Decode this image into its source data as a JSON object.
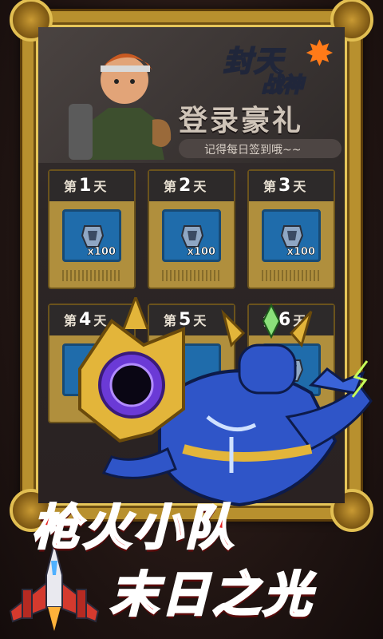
{
  "logo": {
    "line1": "封天",
    "line2": "战神"
  },
  "banner": {
    "title": "登录豪礼",
    "subtitle": "记得每日签到哦~~"
  },
  "days": [
    {
      "prefix": "第",
      "num": "1",
      "suffix": "天",
      "qty": "x100"
    },
    {
      "prefix": "第",
      "num": "2",
      "suffix": "天",
      "qty": "x100"
    },
    {
      "prefix": "第",
      "num": "3",
      "suffix": "天",
      "qty": "x100"
    },
    {
      "prefix": "第",
      "num": "4",
      "suffix": "天",
      "qty": ""
    },
    {
      "prefix": "第",
      "num": "5",
      "suffix": "天",
      "qty": ""
    },
    {
      "prefix": "第",
      "num": "6",
      "suffix": "天",
      "qty": ""
    }
  ],
  "promo": {
    "line1": "枪火小队",
    "line2": "末日之光"
  },
  "colors": {
    "frame_gold": "#b8902e",
    "item_blue": "#1f6cab",
    "title_red": "#e62323"
  },
  "icons": {
    "reward_item": "ore-crystal-icon",
    "ship": "fighter-jet-icon",
    "monster": "armored-titan-character"
  }
}
